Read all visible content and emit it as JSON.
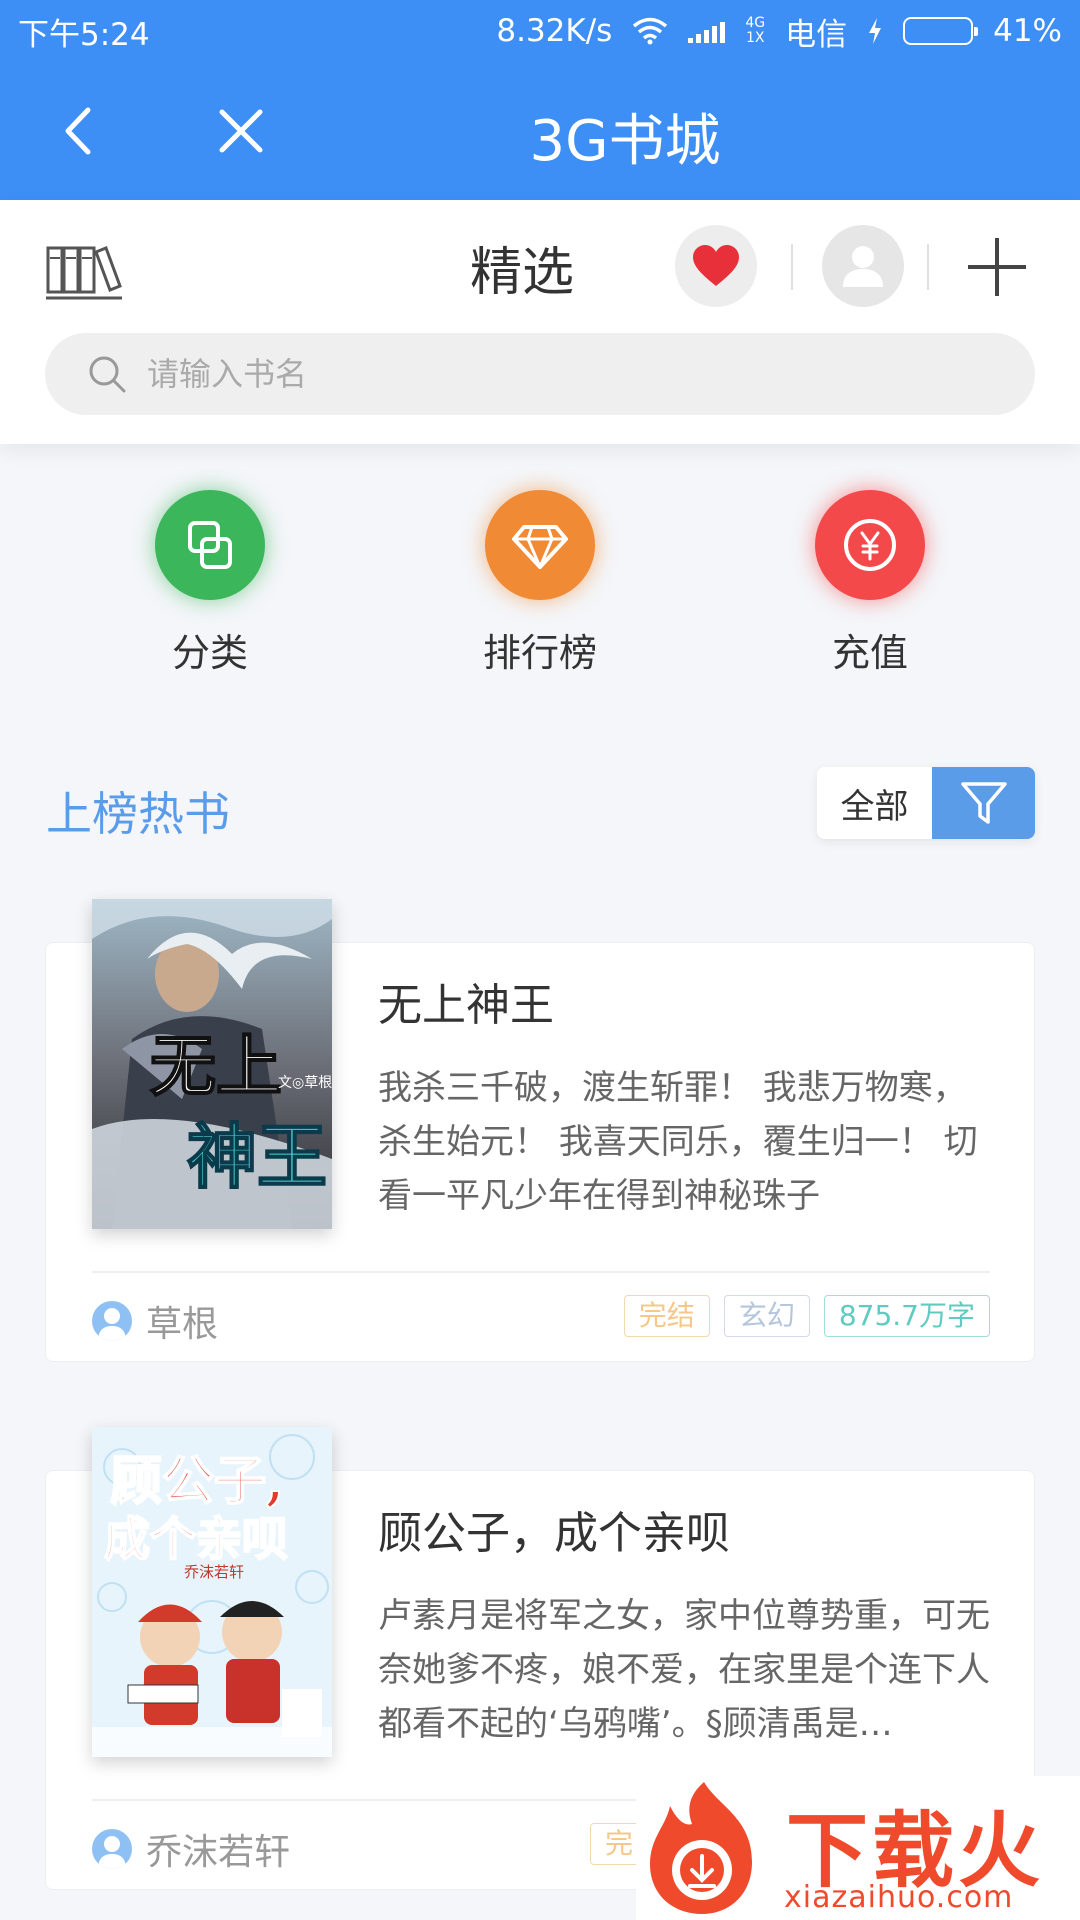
{
  "status_bar": {
    "time": "下午5:24",
    "speed": "8.32K/s",
    "network_top": "4G",
    "network_bottom": "1X",
    "carrier": "电信",
    "battery": "41%",
    "battery_level": 0.41
  },
  "title_bar": {
    "title": "3G书城"
  },
  "header": {
    "tab": "精选"
  },
  "search": {
    "placeholder": "请输入书名"
  },
  "quick_entries": [
    {
      "label": "分类",
      "color": "#3cb65a"
    },
    {
      "label": "排行榜",
      "color": "#f08a35"
    },
    {
      "label": "充值",
      "color": "#f4494b"
    }
  ],
  "section": {
    "title": "上榜热书",
    "filter_label": "全部"
  },
  "books": [
    {
      "title": "无上神王",
      "description": "我杀三千破，渡生斩罪！ 我悲万物寒，杀生始元！ 我喜天同乐，覆生归一！ 切看一平凡少年在得到神秘珠子",
      "author": "草根",
      "status": "完结",
      "genre": "玄幻",
      "words": "875.7万字",
      "cover_text": "无上神王",
      "cover_sub": "文◎草根"
    },
    {
      "title": "顾公子，成个亲呗",
      "description": "卢素月是将军之女，家中位尊势重，可无奈她爹不疼，娘不爱，在家里是个连下人都看不起的‘乌鸦嘴’。§顾清禹是…",
      "author": "乔沫若轩",
      "status": "完",
      "cover_text": "顾公子，成个亲呗",
      "cover_sub": "乔沫若轩"
    }
  ],
  "watermark": {
    "text": "下载火",
    "url": "xiazaihuo.com"
  },
  "colors": {
    "primary": "#3d8ef5",
    "accent": "#5b9ce8"
  }
}
